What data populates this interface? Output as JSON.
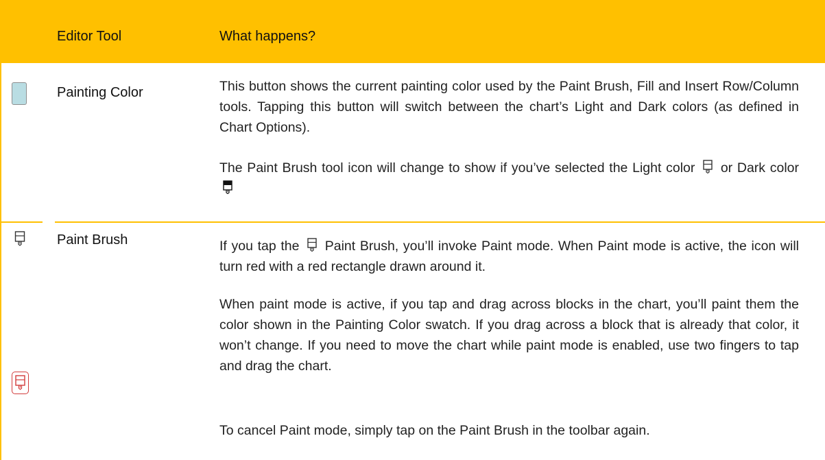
{
  "table": {
    "headers": {
      "tool": "Editor Tool",
      "happens": "What happens?"
    },
    "rows": [
      {
        "tool": "Painting Color",
        "swatch_color": "#b9dde3",
        "paragraphs": [
          "This button shows the current painting color used by the Paint Brush, Fill and Insert Row/Column tools. Tapping this button will switch between the chart’s Light and Dark colors (as defined in Chart Options)."
        ],
        "p2_before": "The Paint Brush tool icon will change to show if you’ve selected the Light color",
        "p2_middle": "or Dark color",
        "light_icon": "paint-brush-light-icon",
        "dark_icon": "paint-brush-dark-icon"
      },
      {
        "tool": "Paint Brush",
        "icons": [
          "paint-brush-icon",
          "paint-brush-active-icon"
        ],
        "p1_before": "If you tap the",
        "p1_after": "Paint Brush, you’ll invoke Paint mode. When Paint mode is active, the icon will turn red with a red rectangle drawn around it.",
        "p2": "When paint mode is active, if you tap and drag across blocks in the chart, you’ll paint them the color shown in the Painting Color swatch. If you drag across a block that is already that color, it won’t change. If you need to move the chart while paint mode is enabled, use two fingers to tap and drag the chart.",
        "p3": "To cancel Paint mode, simply tap on the Paint Brush in the toolbar again."
      }
    ],
    "accent_color": "#ffc000",
    "active_icon_color": "#d23c3c"
  }
}
